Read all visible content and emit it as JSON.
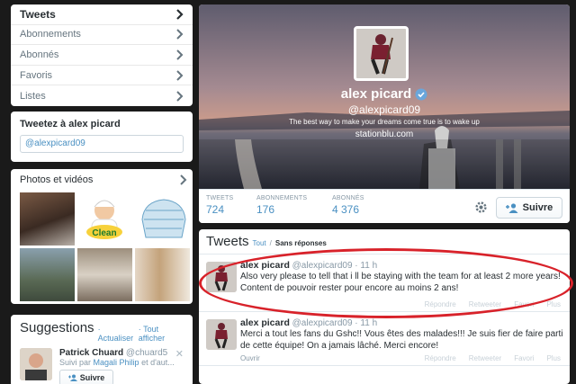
{
  "nav": {
    "items": [
      {
        "label": "Tweets"
      },
      {
        "label": "Abonnements"
      },
      {
        "label": "Abonnés"
      },
      {
        "label": "Favoris"
      },
      {
        "label": "Listes"
      }
    ]
  },
  "tweet_to": {
    "title": "Tweetez à alex picard",
    "value": "@alexpicard09"
  },
  "photos": {
    "title": "Photos et vidéos"
  },
  "suggestions": {
    "title": "Suggestions",
    "refresh": "· Actualiser",
    "all": "· Tout afficher",
    "user": {
      "name": "Patrick Chuard",
      "handle": "@chuard5",
      "followed_by_prefix": "Suivi par ",
      "followed_by": "Magali Philip",
      "followed_by_suffix": " et d'aut...",
      "follow_label": "Suivre"
    }
  },
  "profile": {
    "name": "alex picard",
    "handle": "@alexpicard09",
    "bio": "The best way to make your dreams come true is to wake up",
    "link": "stationblu.com",
    "stats": [
      {
        "label": "Tweets",
        "value": "724"
      },
      {
        "label": "Abonnements",
        "value": "176"
      },
      {
        "label": "Abonnés",
        "value": "4 376"
      }
    ],
    "follow_label": "Suivre"
  },
  "tweets": {
    "title": "Tweets",
    "filter_all": "Tout",
    "separator": "/",
    "filter_noreplies": "Sans réponses",
    "list": [
      {
        "name": "alex picard",
        "handle": "@alexpicard09",
        "time": "· 11 h",
        "text": "Also very please to tell that i ll be staying with the team for at least 2 more years! Content de pouvoir rester pour encore au moins 2 ans!",
        "actions": [
          "Répondre",
          "Retweeter",
          "Favori",
          "Plus"
        ]
      },
      {
        "name": "alex picard",
        "handle": "@alexpicard09",
        "time": "· 11 h",
        "text": "Merci a tout les fans du Gshc!! Vous êtes  des malades!!! Je suis fier de faire parti de cette équipe! On a jamais lâché. Merci encore!",
        "open": "Ouvrir",
        "actions": [
          "Répondre",
          "Retweeter",
          "Favori",
          "Plus"
        ]
      }
    ]
  },
  "colors": {
    "link": "#4a90c2",
    "annotation": "#d8222a",
    "page_bg": "#1a1a1a"
  }
}
